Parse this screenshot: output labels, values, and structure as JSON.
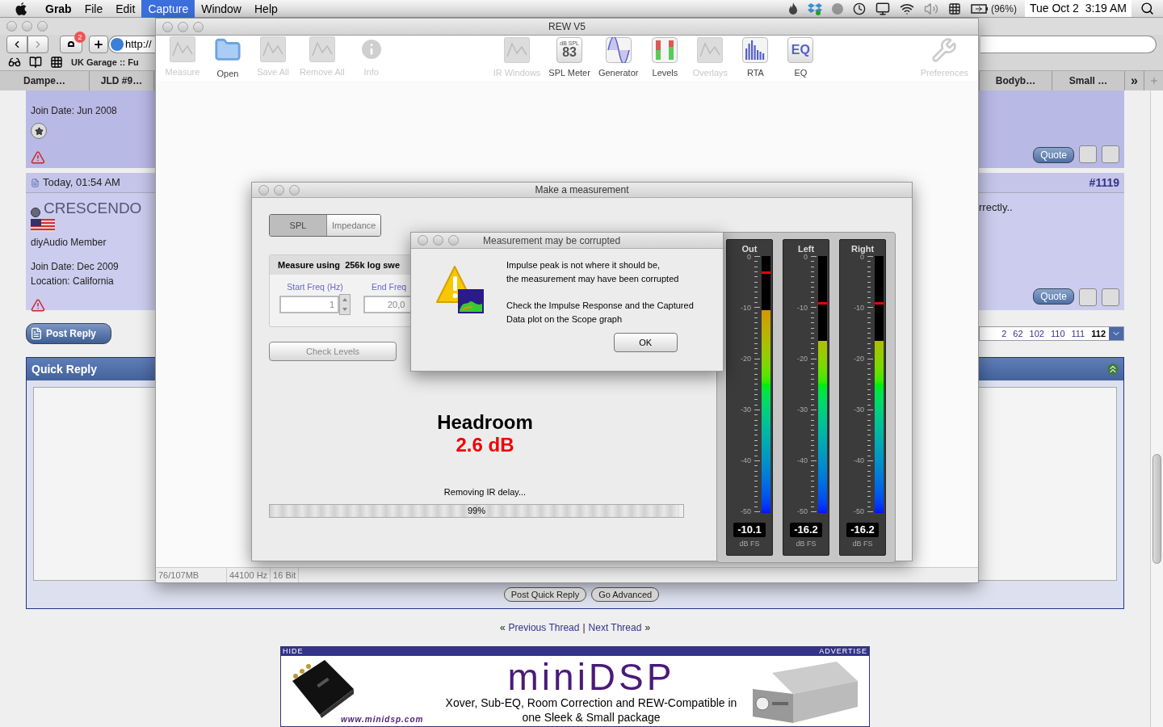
{
  "menu_bar": {
    "menus": [
      {
        "label": "Grab",
        "kind": "app",
        "selected": false
      },
      {
        "label": "File",
        "kind": "menu",
        "selected": false
      },
      {
        "label": "Edit",
        "kind": "menu",
        "selected": false
      },
      {
        "label": "Capture",
        "kind": "menu",
        "selected": true
      },
      {
        "label": "Window",
        "kind": "menu",
        "selected": false
      },
      {
        "label": "Help",
        "kind": "menu",
        "selected": false
      }
    ],
    "battery": "(96%)",
    "clock": "Tue Oct 2  3:19 AM"
  },
  "browser": {
    "badge": "2",
    "url": "http://",
    "bookmark": "UK Garage :: Fu",
    "tabs_left": [
      "Dampe…",
      "JLD #9…"
    ],
    "tabs_right": [
      "Bodyb…",
      "Small …"
    ],
    "tab_more": "»"
  },
  "forum": {
    "post1": {
      "join_date": "Join Date: Jun 2008",
      "quote": "Quote"
    },
    "post2": {
      "time": "Today, 01:54 AM",
      "number": "#1119",
      "username": "CRESCENDO",
      "member_title": "diyAudio Member",
      "join_date": "Join Date: Dec 2009",
      "location": "Location: California",
      "text": "rrectly..",
      "quote": "Quote"
    },
    "post_reply": "Post Reply",
    "pages": [
      {
        "label": "2",
        "selected": false
      },
      {
        "label": "62",
        "selected": false
      },
      {
        "label": "102",
        "selected": false
      },
      {
        "label": "110",
        "selected": false
      },
      {
        "label": "111",
        "selected": false
      },
      {
        "label": "112",
        "selected": true
      }
    ],
    "quick_reply": {
      "title": "Quick Reply",
      "buttons": [
        "Post Quick Reply",
        "Go Advanced"
      ]
    },
    "thread_nav": {
      "prev_mark": "«",
      "prev": "Previous Thread",
      "separator": "|",
      "next": "Next Thread",
      "next_mark": "»"
    },
    "ad": {
      "hide": "HIDE",
      "advertise": "ADVERTISE",
      "logo": "miniDSP",
      "lines": [
        "Xover, Sub-EQ, Room Correction and REW-Compatible in",
        "one Sleek & Small package"
      ],
      "url": "www.minidsp.com"
    }
  },
  "rew": {
    "title": "REW V5",
    "toolbar": [
      [
        {
          "label": "Measure",
          "kind": "measure",
          "disabled": true
        },
        {
          "label": "Open",
          "kind": "open",
          "disabled": false
        },
        {
          "label": "Save All",
          "kind": "save",
          "disabled": true
        },
        {
          "label": "Remove All",
          "kind": "remove",
          "disabled": true
        },
        {
          "label": "Info",
          "kind": "info",
          "disabled": true
        }
      ],
      [
        {
          "label": "IR Windows",
          "kind": "ir",
          "disabled": true
        },
        {
          "label": "SPL Meter",
          "kind": "spl",
          "disabled": false,
          "icon_caption": "dB SPL",
          "icon_value": "83"
        },
        {
          "label": "Generator",
          "kind": "generator",
          "disabled": false
        },
        {
          "label": "Levels",
          "kind": "levels",
          "disabled": false
        },
        {
          "label": "Overlays",
          "kind": "overlays",
          "disabled": true
        },
        {
          "label": "RTA",
          "kind": "rta",
          "disabled": false
        },
        {
          "label": "EQ",
          "kind": "eq",
          "disabled": false,
          "icon_text": "EQ"
        }
      ],
      [
        {
          "label": "Preferences",
          "kind": "prefs",
          "disabled": true
        }
      ]
    ],
    "status": [
      "76/107MB",
      "44100 Hz",
      "16 Bit"
    ]
  },
  "measure_dialog": {
    "title": "Make a measurement",
    "modes": [
      {
        "label": "SPL",
        "selected": true
      },
      {
        "label": "Impedance",
        "selected": false
      }
    ],
    "panel_title": "Measure using  256k log swe",
    "fields": [
      {
        "label": "Start Freq (Hz)",
        "value": "1",
        "stepper": true
      },
      {
        "label": "End Freq",
        "value": "20,0",
        "stepper": false
      }
    ],
    "check_levels": "Check Levels",
    "headroom_label": "Headroom",
    "headroom_value": "2.6 dB",
    "progress": {
      "caption": "Removing IR delay...",
      "reading": "99%",
      "level": 0.99
    },
    "meters": [
      {
        "name": "Out",
        "level": 0.79,
        "reading": "-10.1",
        "unit": "dB FS",
        "scale": [
          "0",
          "-10",
          "-20",
          "-30",
          "-40",
          "-50"
        ]
      },
      {
        "name": "Left",
        "level": 0.67,
        "reading": "-16.2",
        "unit": "dB FS",
        "scale": [
          "0",
          "-10",
          "-20",
          "-30",
          "-40",
          "-50"
        ]
      },
      {
        "name": "Right",
        "level": 0.67,
        "reading": "-16.2",
        "unit": "dB FS",
        "scale": [
          "0",
          "-10",
          "-20",
          "-30",
          "-40",
          "-50"
        ]
      }
    ]
  },
  "alert": {
    "title": "Measurement may be corrupted",
    "paragraphs": [
      [
        "Impulse peak is not where it should be,",
        "the measurement may have been corrupted"
      ],
      [
        "Check the Impulse Response and the Captured",
        "Data plot on the Scope graph"
      ]
    ],
    "button": "OK"
  }
}
